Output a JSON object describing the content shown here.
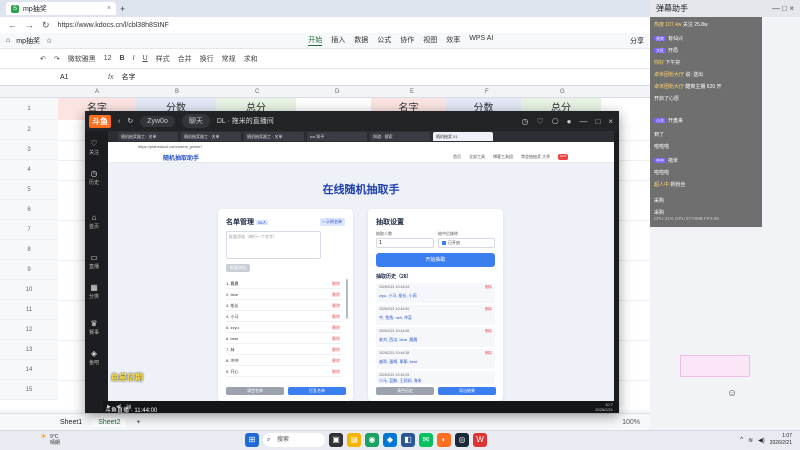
{
  "browser": {
    "tab_title": "mp抽奖",
    "url": "https://www.kdocs.cn/l/cbl38h8StNF"
  },
  "sheet": {
    "doc_name": "mp抽奖",
    "menus": [
      "开始",
      "插入",
      "数据",
      "公式",
      "协作",
      "视图",
      "效率",
      "WPS AI"
    ],
    "active_menu": "开始",
    "right": [
      "分享",
      "发送"
    ],
    "toolbar": [
      "微软雅黑",
      "12",
      "B",
      "I",
      "U",
      "样式",
      "合并",
      "换行",
      "常规",
      "求和"
    ],
    "cell_ref": "A1",
    "fx": "fx",
    "formula": "名字",
    "columns": [
      "A",
      "B",
      "C",
      "D",
      "E",
      "F",
      "G"
    ],
    "row_numbers": [
      "1",
      "2",
      "3",
      "4",
      "5",
      "6",
      "7",
      "8",
      "9",
      "10",
      "11",
      "12",
      "13",
      "14",
      "15"
    ],
    "header_cells": [
      "名字",
      "分数",
      "总分",
      "",
      "名字",
      "分数",
      "总分"
    ],
    "sheet_tabs": [
      "Sheet1",
      "Sheet2"
    ],
    "active_sheet": "Sheet2",
    "add_sheet": "+",
    "zoom": "100%"
  },
  "douyu": {
    "logo": "斗鱼",
    "user": "Zyw0o",
    "chat_btn": "聊天",
    "live_title": "DL · 拖米的直播间",
    "sidebar": [
      "关注",
      "历史",
      "首页",
      "直播",
      "分类",
      "赛事",
      "鱼吧"
    ],
    "inner_tabs": [
      "随机抽奖器工 · 名单",
      "随机抽奖器工 · 名单",
      "随机抽奖器工 · 名单",
      "nw 知乎",
      "知道 · 搜索",
      "随机抽奖 01"
    ],
    "inner_url": "https://plabsstool.com/name_picker/",
    "app": {
      "brand": "随机抽取助手",
      "nav": [
        "首页",
        "全部工具",
        "博客工具组",
        "常会抽抽奖 大师"
      ],
      "nav_hot": "HOT",
      "title": "在线随机抽取手",
      "left_card": {
        "title": "名单管理",
        "count": "26人",
        "import_btn": "+ 示例名单",
        "textarea_placeholder": "批量添加（每行一个名字）",
        "add_btn": "批量添加",
        "names": [
          "1. 晨晨",
          "2. blue",
          "3. 船长",
          "4. 小马",
          "5. zzyu",
          "6. best",
          "7. 妹",
          "8. 冲冲",
          "9. 开心"
        ],
        "delete_label": "删除",
        "clear_btn": "清空名单",
        "draw_btn": "打乱名单"
      },
      "right_card": {
        "title": "抽取设置",
        "count_label": "抽取人数",
        "count_value": "1",
        "repeat_label": "抽中后移除",
        "repeat_value": "已开启",
        "start_btn": "开始抽取",
        "history_title": "抽取历史（28）",
        "history": [
          {
            "time": "2026/2/21 10:44:54",
            "names": "ziyu, 小马, 船长, 小芮"
          },
          {
            "time": "2026/2/21 10:44:50",
            "names": "中, 兔兔, nell, 冲蕊"
          },
          {
            "time": "2026/2/21 10:44:46",
            "names": "老刘, 西瓜, blue, 晨晨"
          },
          {
            "time": "2026/2/21 10:44:38",
            "names": "越哥, 蛋嘀, 耶耶, best"
          },
          {
            "time": "2026/2/21 10:44:25",
            "names": "小马, 蓝鲸, 王润润, 海米"
          }
        ],
        "history_delete": "删除",
        "clear_history": "清空历史",
        "export_btn": "导出结果"
      }
    },
    "bottom_time": "10:7",
    "bottom_date": "2026/2/21",
    "overlay_text": "鱼星亿期",
    "overlay_sub": "斗鱼直播 · 11:44:00"
  },
  "chat": {
    "title": "弹幕助手",
    "messages": [
      {
        "u": "热度 107.4w",
        "t": "关注 25.8w"
      },
      {
        "u": "贵宾",
        "t": "有仙兴"
      },
      {
        "u": "大旺",
        "t": "开局"
      },
      {
        "u": "你好",
        "t": "下午好"
      },
      {
        "u": "卓米团粉大厅",
        "t": "说: 送出"
      },
      {
        "u": "卓米团粉大厅",
        "t": "酷爽主播 620 开"
      },
      {
        "u": "",
        "t": "开启了心愿"
      },
      {
        "u": "小羊",
        "t": "开盘来"
      },
      {
        "u": "",
        "t": "到了"
      },
      {
        "u": "",
        "t": "啦啦啦"
      },
      {
        "u": "中中",
        "t": "拖米"
      },
      {
        "u": "",
        "t": "啦啦啦"
      },
      {
        "u": "超人中",
        "t": "新粉丝"
      },
      {
        "u": "",
        "t": "采购"
      },
      {
        "u": "",
        "t": "采购"
      }
    ],
    "stats": "CPU 21%  GPU 5774MB  FPS 60"
  },
  "taskbar": {
    "temp": "9°C",
    "weather": "晴朗",
    "search": "搜索",
    "time": "1:07",
    "date": "2026/2/21"
  },
  "colors": {
    "kdocs_green": "#1d6f3a",
    "douyu_orange": "#ff6d1f",
    "accent_blue": "#3b7ef0",
    "title_blue": "#1e40af",
    "delete_red": "#e25555"
  }
}
